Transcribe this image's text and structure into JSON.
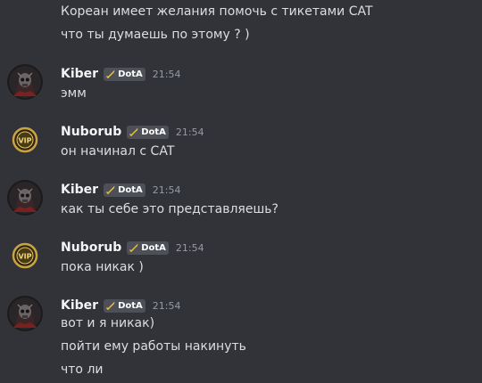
{
  "continuation": [
    "Кореан имеет желания помочь с тикетами CAT",
    "что ты думаешь по этому ? )"
  ],
  "tag_label": "DotA",
  "groups": [
    {
      "user": "Kiber",
      "time": "21:54",
      "avatar": "dark-skull-avatar",
      "messages": [
        "эмм"
      ]
    },
    {
      "user": "Nuborub",
      "time": "21:54",
      "avatar": "gold-vip-avatar",
      "messages": [
        "он начинал с CAT"
      ]
    },
    {
      "user": "Kiber",
      "time": "21:54",
      "avatar": "dark-skull-avatar",
      "messages": [
        "как ты себе это представляешь?"
      ]
    },
    {
      "user": "Nuborub",
      "time": "21:54",
      "avatar": "gold-vip-avatar",
      "messages": [
        "пока никак )"
      ]
    },
    {
      "user": "Kiber",
      "time": "21:54",
      "avatar": "dark-skull-avatar",
      "messages": [
        "вот и я никак)",
        "пойти ему работы накинуть",
        "что ли"
      ]
    }
  ]
}
